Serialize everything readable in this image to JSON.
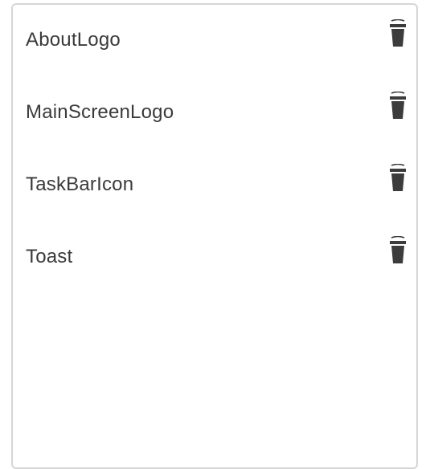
{
  "assets": {
    "items": [
      {
        "label": "AboutLogo",
        "action_icon": "trash-icon"
      },
      {
        "label": "MainScreenLogo",
        "action_icon": "trash-icon"
      },
      {
        "label": "TaskBarIcon",
        "action_icon": "trash-icon"
      },
      {
        "label": "Toast",
        "action_icon": "trash-icon"
      }
    ]
  },
  "colors": {
    "text": "#3a3a3a",
    "icon": "#3c3c3c",
    "border": "#d6d6d6",
    "background": "#ffffff"
  }
}
